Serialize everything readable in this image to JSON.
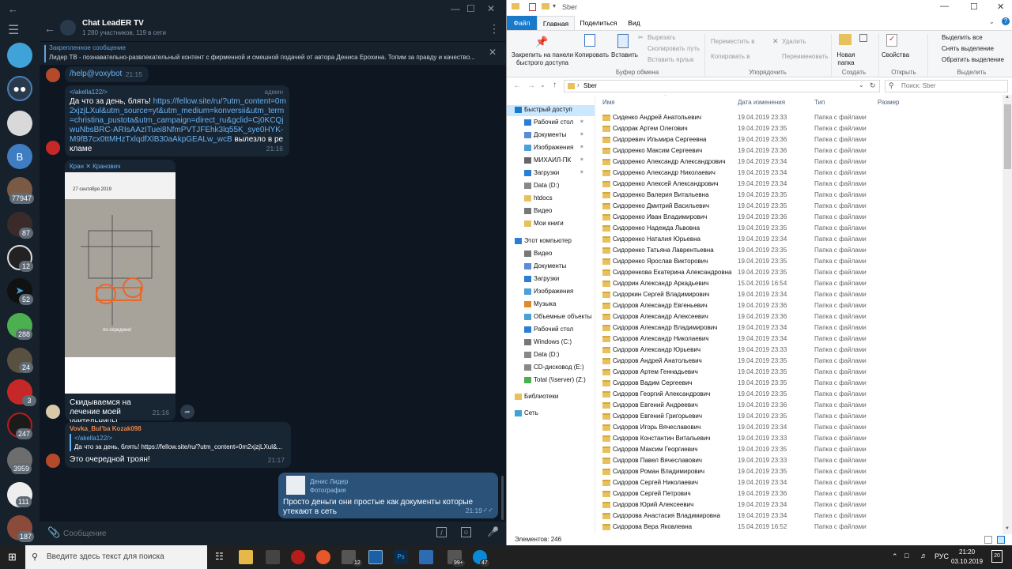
{
  "telegram": {
    "chat_title": "Chat LeadER TV",
    "chat_subtitle": "1 280 участников, 119 в сети",
    "pinned_label": "Закрепленное сообщение",
    "pinned_text": "Лидер ТВ - познавательно-развлекательный контент с фирменной и смешной подачей от автора Дениса Ерохина. Топим за правду и качество...",
    "rail_badges": [
      "77947",
      "87",
      "12",
      "52",
      "288",
      "24",
      "3",
      "247",
      "3959",
      "111",
      "187"
    ],
    "rail_letter_b": "B",
    "messages": {
      "m1_text": "/help@voxybot",
      "m1_time": "21:15",
      "m2_user": "</akella122/>",
      "m2_role": "админ",
      "m2_text": "Да что за день, блять!",
      "m2_link": "https://fellow.site/ru/?utm_content=0m2xjzjLXul&utm_source=yt&utm_medium=konversii&utm_term=christina_pustota&utm_campaign=direct_ru&gclid=Cj0KCQjwuNbsBRC-ARIsAAzITuei8NfmPVTJFEhk3lq55K_sye0HYK-M9fB7cx0ttMHzTxlqdfXlB30aAkpGEALw_wcB",
      "m2_tail": "вылезло в рекламе",
      "m2_time": "21:16",
      "m3_user": "Кран ✕ Кранович",
      "m3_photo_date": "27 сентября 2019",
      "m3_photo_caption": "по середине!",
      "m3_text": "Скидываемся на лечение моей учительницы.",
      "m3_time": "21:16",
      "m4_user": "Vovka_Bul'ba Kozak098",
      "m4_reply_user": "</akella122/>",
      "m4_reply_text": "Да что за день, блять! https://fellow.site/ru/?utm_content=0m2xjzjLXul&...",
      "m4_text": "Это очередной троян!",
      "m4_time": "21:17",
      "m5_reply_user": "Денис Лидер",
      "m5_reply_type": "Фотография",
      "m5_text": "Просто деньги они простые как документы которые утекают в сеть",
      "m5_time": "21:19"
    },
    "input_placeholder": "Сообщение"
  },
  "explorer": {
    "title": "Sber",
    "tabs": [
      "Файл",
      "Главная",
      "Поделиться",
      "Вид"
    ],
    "ribbon": {
      "pin": "Закрепить на панели быстрого доступа",
      "copy": "Копировать",
      "paste": "Вставить",
      "cut": "Вырезать",
      "copy_path": "Скопировать путь",
      "paste_shortcut": "Вставить ярлык",
      "move_to": "Переместить в",
      "copy_to": "Копировать в",
      "delete": "Удалить",
      "rename": "Переименовать",
      "new_folder": "Новая папка",
      "properties": "Свойства",
      "select_all": "Выделить все",
      "select_none": "Снять выделение",
      "invert": "Обратить выделение",
      "grp_clipboard": "Буфер обмена",
      "grp_organize": "Упорядочить",
      "grp_create": "Создать",
      "grp_open": "Открыть",
      "grp_select": "Выделить"
    },
    "address": "Sber",
    "search_placeholder": "Поиск: Sber",
    "nav": [
      "Быстрый доступ",
      "Рабочий стол",
      "Документы",
      "Изображения",
      "МИХАИЛ-ПК",
      "Загрузки",
      "Data (D:)",
      "htdocs",
      "Видео",
      "Мои книги",
      "Этот компьютер",
      "Видео",
      "Документы",
      "Загрузки",
      "Изображения",
      "Музыка",
      "Объемные объекты",
      "Рабочий стол",
      "Windows (C:)",
      "Data (D:)",
      "CD-дисковод (E:)",
      "Total (\\\\server) (Z:)",
      "Библиотеки",
      "Сеть"
    ],
    "columns": [
      "Имя",
      "Дата изменения",
      "Тип",
      "Размер"
    ],
    "rows": [
      [
        "Сиденко Андрей Анатольевич",
        "19.04.2019 23:33"
      ],
      [
        "Сидорак Артем Олегович",
        "19.04.2019 23:35"
      ],
      [
        "Сидоревич  Ильмира  Сергеевна",
        "19.04.2019 23:36"
      ],
      [
        "Сидоренко  Максим  Сергеевич",
        "19.04.2019 23:36"
      ],
      [
        "Сидоренко Александр Александрович",
        "19.04.2019 23:34"
      ],
      [
        "Сидоренко Александр Николаевич",
        "19.04.2019 23:34"
      ],
      [
        "Сидоренко Алексей Александрович",
        "19.04.2019 23:34"
      ],
      [
        "Сидоренко Валерия Витальевна",
        "19.04.2019 23:35"
      ],
      [
        "Сидоренко Дмитрий Васильевич",
        "19.04.2019 23:35"
      ],
      [
        "Сидоренко Иван Владимирович",
        "19.04.2019 23:36"
      ],
      [
        "Сидоренко Надежда Львовна",
        "19.04.2019 23:35"
      ],
      [
        "Сидоренко Наталия Юрьевна",
        "19.04.2019 23:34"
      ],
      [
        "Сидоренко Татьяна Лаврентьевна",
        "19.04.2019 23:35"
      ],
      [
        "Сидоренко Ярослав Викторович",
        "19.04.2019 23:35"
      ],
      [
        "Сидоренкова Екатерина Александровна",
        "19.04.2019 23:35"
      ],
      [
        "Сидорин Александр Аркадьевич",
        "15.04.2019 16:54"
      ],
      [
        "Сидоркин Сергей Владимирович",
        "19.04.2019 23:34"
      ],
      [
        "Сидоров Александр  Евгеньевич",
        "19.04.2019 23:36"
      ],
      [
        "Сидоров Александр Алексеевич",
        "19.04.2019 23:36"
      ],
      [
        "Сидоров Александр Владимирович",
        "19.04.2019 23:34"
      ],
      [
        "Сидоров Александр Николаевич",
        "19.04.2019 23:34"
      ],
      [
        "Сидоров Александр Юрьевич",
        "19.04.2019 23:33"
      ],
      [
        "Сидоров Андрей Анатольевич",
        "19.04.2019 23:35"
      ],
      [
        "Сидоров Артем Геннадьевич",
        "19.04.2019 23:35"
      ],
      [
        "Сидоров Вадим Сергеевич",
        "19.04.2019 23:35"
      ],
      [
        "Сидоров Георгий Александрович",
        "19.04.2019 23:35"
      ],
      [
        "Сидоров Евгений Андреевич",
        "19.04.2019 23:36"
      ],
      [
        "Сидоров Евгений Григорьевич",
        "19.04.2019 23:35"
      ],
      [
        "Сидоров Игорь Вячеславович",
        "19.04.2019 23:34"
      ],
      [
        "Сидоров Константин Витальевич",
        "19.04.2019 23:33"
      ],
      [
        "Сидоров Максим Георгиевич",
        "19.04.2019 23:35"
      ],
      [
        "Сидоров Павел Вячеславович",
        "19.04.2019 23:33"
      ],
      [
        "Сидоров Роман Владимирович",
        "19.04.2019 23:35"
      ],
      [
        "Сидоров Сергей Николаевич",
        "19.04.2019 23:34"
      ],
      [
        "Сидоров Сергей Петрович",
        "19.04.2019 23:36"
      ],
      [
        "Сидоров Юрий Алексеевич",
        "19.04.2019 23:34"
      ],
      [
        "Сидорова Анастасия Владимировна",
        "19.04.2019 23:34"
      ],
      [
        "Сидорова Вера Яковлевна",
        "15.04.2019 16:52"
      ]
    ],
    "row_type": "Папка с файлами",
    "status": "Элементов: 246"
  },
  "taskbar": {
    "search_placeholder": "Введите здесь текст для поиска",
    "badges": {
      "b1": "12",
      "b2": "99+",
      "b3": "47"
    },
    "lang": "РУС",
    "time": "21:20",
    "date": "03.10.2019",
    "notif": "20"
  }
}
